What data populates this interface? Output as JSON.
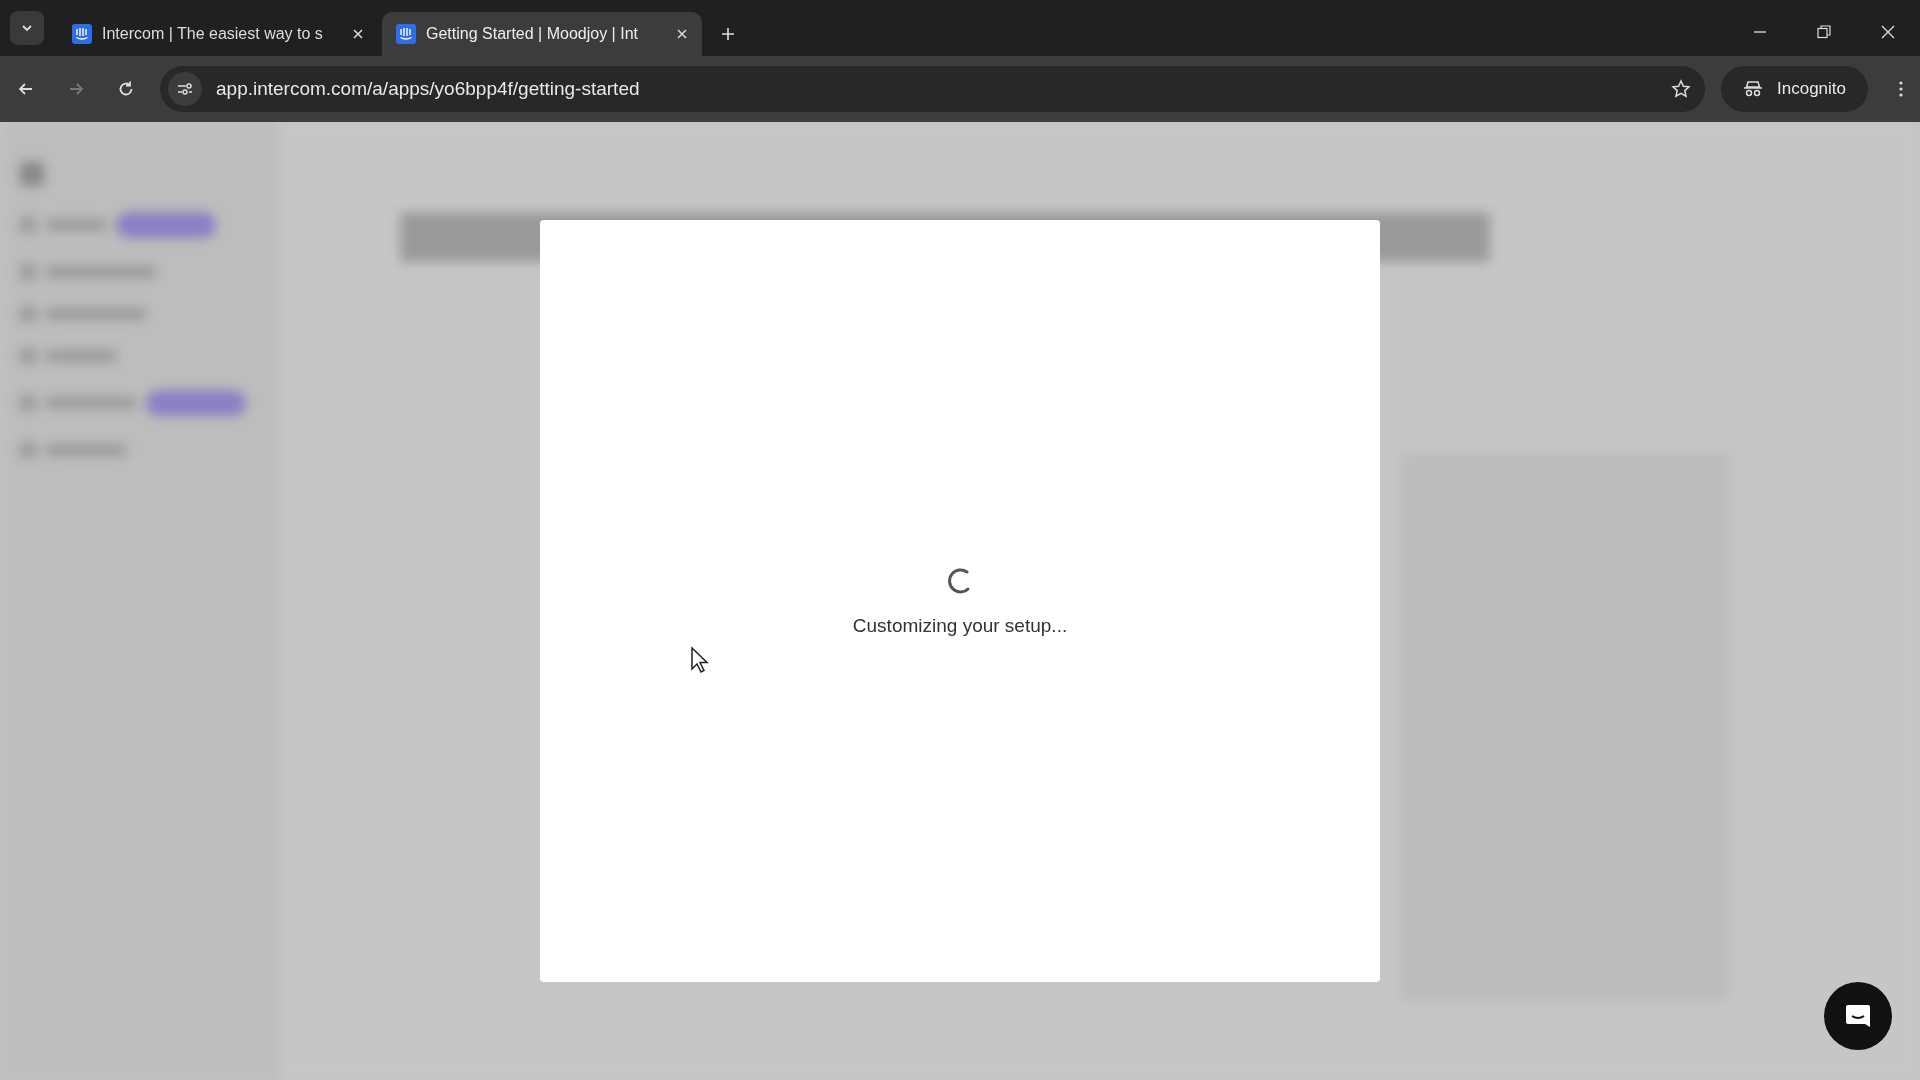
{
  "tabs": [
    {
      "title": "Intercom | The easiest way to s",
      "selected": false
    },
    {
      "title": "Getting Started | Moodjoy | Int",
      "selected": true
    }
  ],
  "address_bar": {
    "url": "app.intercom.com/a/apps/yo6bpp4f/getting-started"
  },
  "profile": {
    "label": "Incognito"
  },
  "modal": {
    "message": "Customizing your setup..."
  }
}
